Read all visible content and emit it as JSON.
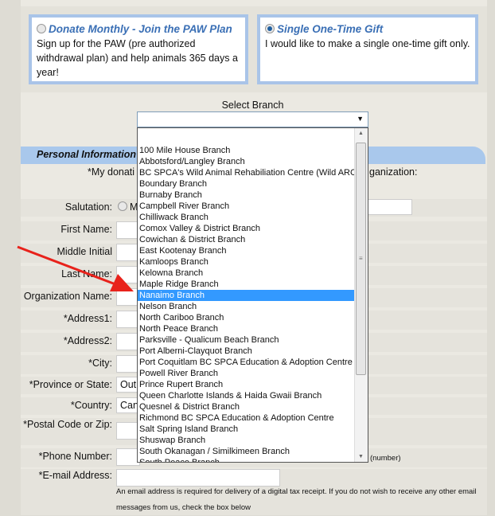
{
  "plans": {
    "monthly": {
      "title": "Donate Monthly - Join the PAW Plan",
      "desc": "Sign up for the PAW (pre authorized withdrawal plan) and help animals 365 days a year!",
      "selected": false
    },
    "single": {
      "title": "Single One-Time Gift",
      "desc": "I would like to make a single one-time gift only.",
      "selected": true
    }
  },
  "branch": {
    "label": "Select Branch",
    "value": "",
    "highlighted": "Nanaimo Branch",
    "options": [
      "",
      "100 Mile House Branch",
      "Abbotsford/Langley Branch",
      "BC SPCA's Wild Animal Rehabiliation Centre (Wild ARC)",
      "Boundary Branch",
      "Burnaby Branch",
      "Campbell River Branch",
      "Chilliwack Branch",
      "Comox Valley & District Branch",
      "Cowichan & District Branch",
      "East Kootenay Branch",
      "Kamloops Branch",
      "Kelowna Branch",
      "Maple Ridge Branch",
      "Nanaimo Branch",
      "Nelson Branch",
      "North Cariboo Branch",
      "North Peace Branch",
      "Parksville - Qualicum Beach Branch",
      "Port Alberni-Clayquot Branch",
      "Port Coquitlam BC SPCA Education & Adoption Centre",
      "Powell River Branch",
      "Prince Rupert Branch",
      "Queen Charlotte Islands & Haida Gwaii Branch",
      "Quesnel & District Branch",
      "Richmond BC SPCA Education & Adoption Centre",
      "Salt Spring Island Branch",
      "Shuswap Branch",
      "South Okanagan / Similkimeen Branch",
      "South Peace Branch"
    ]
  },
  "personal": {
    "header": "Personal Information",
    "org_q_left": "*My donati",
    "org_q_right": "ganization:",
    "salutation": "Salutation:",
    "salutation_opt": "M",
    "first": "First Name:",
    "middle": "Middle Initial",
    "last": "Last Name:",
    "org": "Organization Name:",
    "addr1": "*Address1:",
    "addr2": "*Address2:",
    "city": "*City:",
    "province": "*Province or State:",
    "province_val": "Out",
    "country": "*Country:",
    "country_val": "Can",
    "postal": "*Postal Code or Zip:",
    "phone": "*Phone Number:",
    "phone_hint": "(number)",
    "email": "*E-mail Address:",
    "email_note": "An email address is required for delivery of a digital tax receipt. If you do not wish to receive any other email messages from us, check the box below"
  },
  "colors": {
    "accent": "#3a6fb5",
    "border": "#a9c4e8",
    "highlight": "#3399ff",
    "arrow": "#e8221b"
  }
}
